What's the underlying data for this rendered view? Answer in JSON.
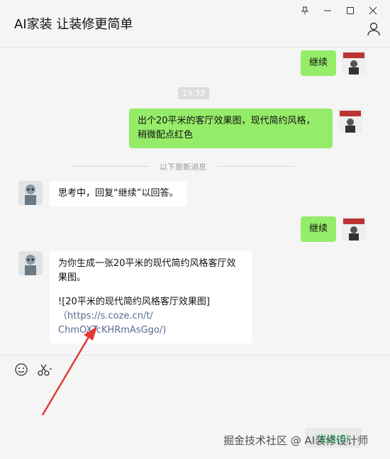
{
  "window": {
    "title": "AI家装 让装修更简单",
    "controls": [
      "pin-icon",
      "minimize-icon",
      "maximize-icon",
      "close-icon"
    ]
  },
  "messages": {
    "m1": {
      "text": "继续",
      "side": "right"
    },
    "time": "19:33",
    "m2": {
      "line1": "出个20平米的客厅效果图，现代简约风格，",
      "line2": "稍微配点红色",
      "side": "right"
    },
    "separator": "以下是新消息",
    "m3": {
      "text": "思考中，回复“继续”以回答。",
      "side": "left"
    },
    "m4": {
      "text": "继续",
      "side": "right"
    },
    "m5": {
      "line1": "为你生成一张20平米的现代简约风格客厅效",
      "line2": "果图。",
      "line3": "![20平米的现代简约风格客厅效果图]",
      "line4": "（https://s.coze.cn/t/",
      "line5": "ChmOXTcKHRmAsGgo/)",
      "side": "left"
    }
  },
  "input": {
    "icons": [
      "emoji-icon",
      "scissors-icon"
    ],
    "send_label": "发送(S)"
  },
  "watermark": "掘金技术社区 @ AI装修设计师",
  "colors": {
    "green_bubble": "#95ec69",
    "white_bubble": "#ffffff",
    "arrow": "#e53935"
  }
}
